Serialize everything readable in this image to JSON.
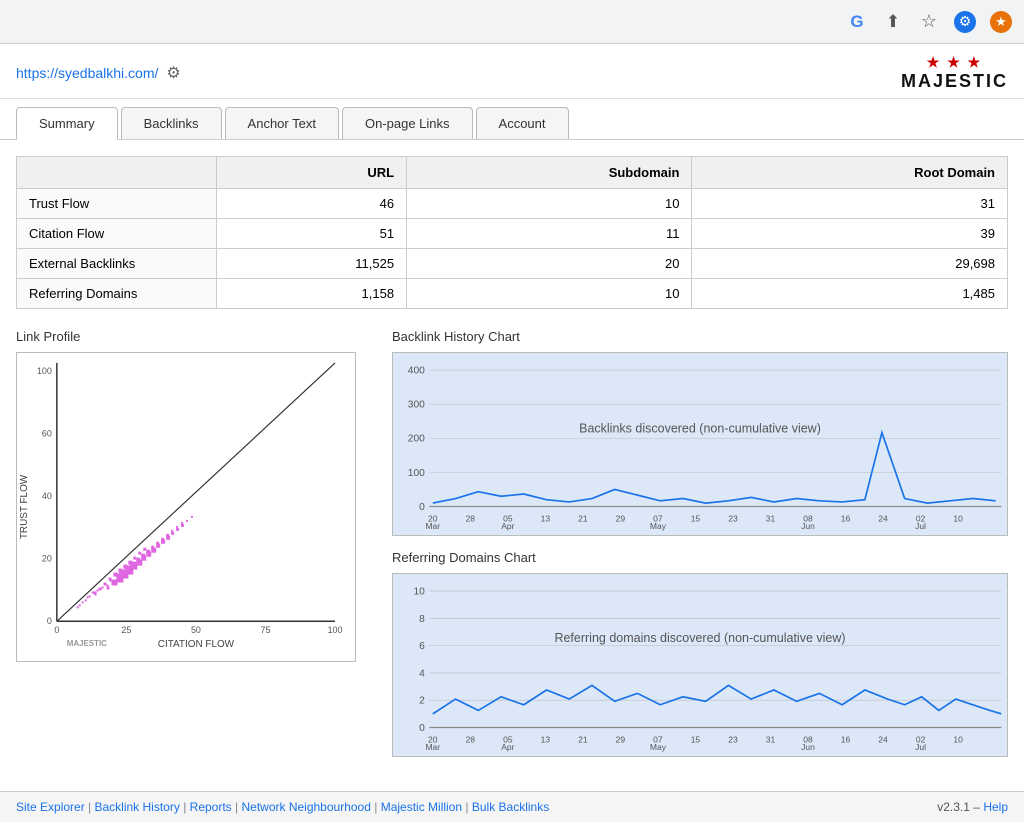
{
  "browser": {
    "icons": {
      "google": "G",
      "share": "⬆",
      "star": "☆",
      "settings": "⚙",
      "extension": "★"
    }
  },
  "top_bar": {
    "url": "https://syedbalkhi.com/",
    "gear_label": "⚙",
    "logo_stars": "★ ★ ★",
    "logo_name": "MAJESTIC"
  },
  "tabs": [
    {
      "label": "Summary",
      "active": true
    },
    {
      "label": "Backlinks",
      "active": false
    },
    {
      "label": "Anchor Text",
      "active": false
    },
    {
      "label": "On-page Links",
      "active": false
    },
    {
      "label": "Account",
      "active": false
    }
  ],
  "summary_table": {
    "headers": [
      "",
      "URL",
      "Subdomain",
      "Root Domain"
    ],
    "rows": [
      {
        "label": "Trust Flow",
        "url": "46",
        "subdomain": "10",
        "root_domain": "31"
      },
      {
        "label": "Citation Flow",
        "url": "51",
        "subdomain": "11",
        "root_domain": "39"
      },
      {
        "label": "External Backlinks",
        "url": "11,525",
        "subdomain": "20",
        "root_domain": "29,698"
      },
      {
        "label": "Referring Domains",
        "url": "1,158",
        "subdomain": "10",
        "root_domain": "1,485"
      }
    ]
  },
  "link_profile": {
    "title": "Link Profile",
    "x_axis": "CITATION FLOW",
    "y_axis": "TRUST FLOW",
    "x_max": "100",
    "y_max": "100",
    "logo": "MAJESTIC"
  },
  "backlink_history": {
    "title": "Backlink History Chart",
    "description": "Backlinks discovered (non-cumulative view)",
    "y_max": 400,
    "x_labels": [
      "20 Mar",
      "28",
      "05 Apr",
      "13",
      "21",
      "29",
      "07 May",
      "15",
      "23",
      "31",
      "08 Jun",
      "16",
      "24",
      "02 Jul",
      "10"
    ]
  },
  "referring_domains_chart": {
    "title": "Referring Domains Chart",
    "description": "Referring domains discovered (non-cumulative view)",
    "y_max": 10,
    "x_labels": [
      "20 Mar",
      "28",
      "05 Apr",
      "13",
      "21",
      "29",
      "07 May",
      "15",
      "23",
      "31",
      "08 Jun",
      "16",
      "24",
      "02 Jul",
      "10"
    ]
  },
  "footer": {
    "links": [
      {
        "label": "Site Explorer",
        "url": "#"
      },
      {
        "label": "Backlink History",
        "url": "#"
      },
      {
        "label": "Reports",
        "url": "#"
      },
      {
        "label": "Network Neighbourhood",
        "url": "#"
      },
      {
        "label": "Majestic Million",
        "url": "#"
      },
      {
        "label": "Bulk Backlinks",
        "url": "#"
      }
    ],
    "version": "v2.3.1",
    "help_label": "Help"
  }
}
